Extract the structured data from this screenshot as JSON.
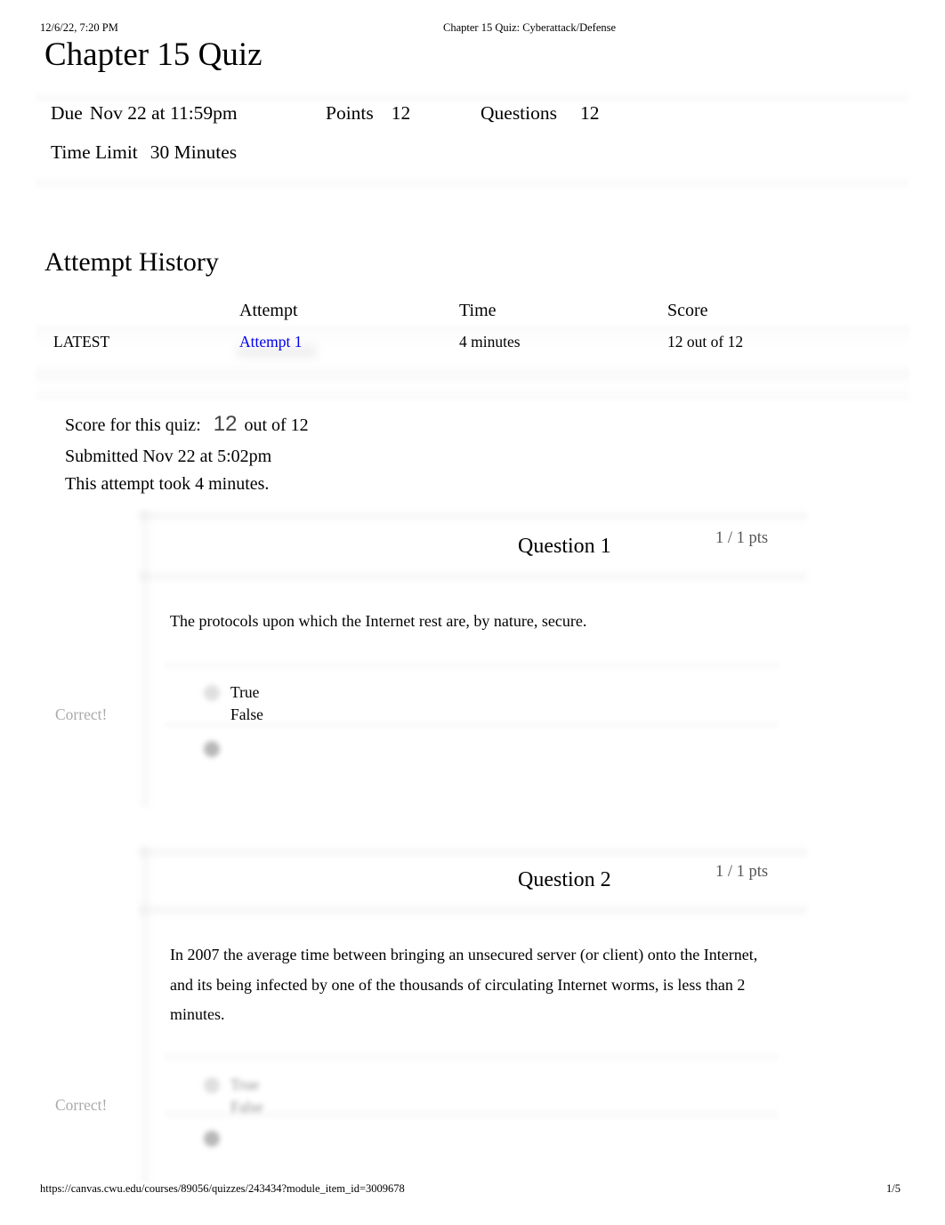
{
  "print_header": {
    "datetime": "12/6/22, 7:20 PM",
    "document_title": "Chapter 15 Quiz: Cyberattack/Defense"
  },
  "print_footer": {
    "url": "https://canvas.cwu.edu/courses/89056/quizzes/243434?module_item_id=3009678",
    "page": "1/5"
  },
  "quiz": {
    "title": "Chapter 15 Quiz",
    "meta": {
      "due_label": "Due",
      "due_value": "Nov 22 at 11:59pm",
      "points_label": "Points",
      "points_value": "12",
      "questions_label": "Questions",
      "questions_value": "12",
      "time_limit_label": "Time Limit",
      "time_limit_value": "30 Minutes"
    }
  },
  "attempt_history": {
    "title": "Attempt History",
    "columns": [
      "",
      "Attempt",
      "Time",
      "Score"
    ],
    "rows": [
      {
        "tag": "LATEST",
        "attempt": "Attempt 1",
        "time": "4 minutes",
        "score": "12 out of 12"
      }
    ]
  },
  "score_summary": {
    "label": "Score for this quiz:",
    "score": "12",
    "out_of": "out of 12",
    "submitted": "Submitted Nov 22 at 5:02pm",
    "duration": "This attempt took 4 minutes."
  },
  "questions": [
    {
      "title": "Question 1",
      "points": "1 / 1 pts",
      "text": "The protocols upon which the Internet rest are, by nature, secure.",
      "answers": [
        "True",
        "False"
      ],
      "selected_index": 1,
      "result": "Correct!"
    },
    {
      "title": "Question 2",
      "points": "1 / 1 pts",
      "text": "In 2007 the average time between bringing an unsecured server (or client) onto the Internet, and its being infected by one of the thousands of circulating Internet worms, is less than 2 minutes.",
      "answers": [
        "True",
        "False"
      ],
      "selected_index": 0,
      "result": "Correct!"
    }
  ],
  "colors": {
    "link": "#0000ee",
    "muted_text": "#aaaaaa",
    "points_text": "#555555"
  }
}
